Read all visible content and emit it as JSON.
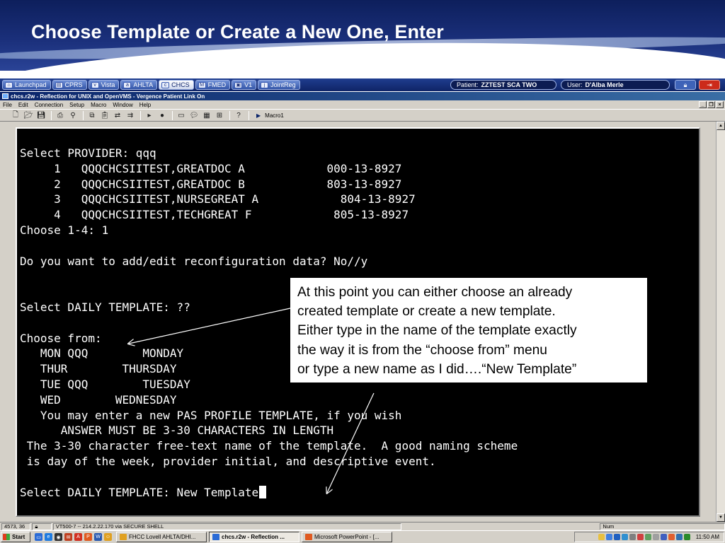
{
  "slide": {
    "title": "Choose Template or Create a New One, Enter"
  },
  "launcher": {
    "apps": [
      {
        "label": "Launchpad",
        "icon": "launchpad-icon"
      },
      {
        "label": "CPRS",
        "icon": "cprs-icon"
      },
      {
        "label": "Vista",
        "icon": "vista-icon"
      },
      {
        "label": "AHLTA",
        "icon": "ahlta-icon"
      },
      {
        "label": "CHCS",
        "icon": "chcs-icon"
      },
      {
        "label": "FMED",
        "icon": "fmed-icon"
      },
      {
        "label": "V1",
        "icon": "v1-icon"
      },
      {
        "label": "JointReg",
        "icon": "jointreg-icon"
      }
    ],
    "patient_label": "Patient:",
    "patient_value": "ZZTEST SCA TWO",
    "user_label": "User:",
    "user_value": "D'Alba Merle"
  },
  "window": {
    "title": "chcs.r2w - Reflection for UNIX and OpenVMS - Vergence Patient Link On",
    "menus": [
      {
        "label": "File"
      },
      {
        "label": "Edit"
      },
      {
        "label": "Connection"
      },
      {
        "label": "Setup"
      },
      {
        "label": "Macro"
      },
      {
        "label": "Window"
      },
      {
        "label": "Help"
      }
    ],
    "toolbar_macro": "Macro1"
  },
  "terminal": {
    "lines": [
      "Select PROVIDER: qqq",
      "     1   QQQCHCSIITEST,GREATDOC A            000-13-8927",
      "     2   QQQCHCSIITEST,GREATDOC B            803-13-8927",
      "     3   QQQCHCSIITEST,NURSEGREAT A            804-13-8927",
      "     4   QQQCHCSIITEST,TECHGREAT F            805-13-8927",
      "Choose 1-4: 1",
      "",
      "Do you want to add/edit reconfiguration data? No//y",
      "",
      "",
      "Select DAILY TEMPLATE: ??",
      "",
      "Choose from:",
      "   MON QQQ        MONDAY",
      "   THUR        THURSDAY",
      "   TUE QQQ        TUESDAY",
      "   WED        WEDNESDAY",
      "   You may enter a new PAS PROFILE TEMPLATE, if you wish",
      "      ANSWER MUST BE 3-30 CHARACTERS IN LENGTH",
      " The 3-30 character free-text name of the template.  A good naming scheme",
      " is day of the week, provider initial, and descriptive event.",
      "",
      "Select DAILY TEMPLATE: New Template"
    ]
  },
  "callout": {
    "lines": [
      "At this point you can either choose an already",
      "created template or create a new template.",
      "Either type in the name of the template exactly",
      "the way it is from the “choose from” menu",
      "or type a new name as I did….“New Template”"
    ]
  },
  "status_bar": {
    "cursor_pos": "4573, 36",
    "connection": "VT500-7 -- 214.2.22.170 via SECURE SHELL",
    "num": "Num"
  },
  "taskbar": {
    "start_label": "Start",
    "tasks": [
      {
        "label": "FHCC Lovell AHLTA/DHI..."
      },
      {
        "label": "chcs.r2w - Reflection ..."
      },
      {
        "label": "Microsoft PowerPoint - [..."
      }
    ],
    "clock": "11:50 AM"
  },
  "colors": {
    "header_navy": "#1a2f7a",
    "terminal_bg": "#000000",
    "terminal_fg": "#ffffff"
  }
}
